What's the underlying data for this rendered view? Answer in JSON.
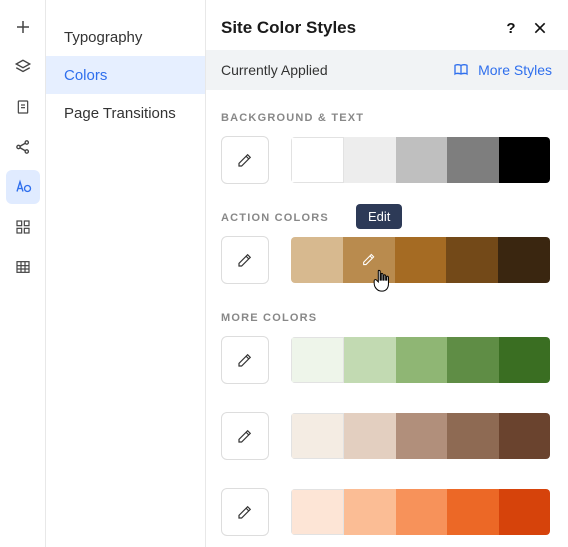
{
  "header": {
    "title": "Site Color Styles",
    "help": "?",
    "close": "×"
  },
  "applied_bar": {
    "label": "Currently Applied",
    "more_styles": "More Styles"
  },
  "menu": {
    "items": [
      {
        "label": "Typography",
        "active": false
      },
      {
        "label": "Colors",
        "active": true
      },
      {
        "label": "Page Transitions",
        "active": false
      }
    ]
  },
  "rail": {
    "items": [
      {
        "name": "add-icon"
      },
      {
        "name": "layers-icon"
      },
      {
        "name": "page-icon"
      },
      {
        "name": "share-icon"
      },
      {
        "name": "design-icon",
        "active": true
      },
      {
        "name": "grid-icon"
      },
      {
        "name": "table-icon"
      }
    ]
  },
  "sections": {
    "background_text": {
      "label": "BACKGROUND & TEXT",
      "swatches": [
        "#ffffff",
        "#ededed",
        "#bfbfbf",
        "#7e7e7e",
        "#000000"
      ]
    },
    "action_colors": {
      "label": "ACTION COLORS",
      "tooltip": "Edit",
      "swatches": [
        "#d7b98f",
        "#b98b4e",
        "#a56b23",
        "#734918",
        "#3a2610"
      ]
    },
    "more_colors": {
      "label": "MORE COLORS",
      "rows": [
        {
          "swatches": [
            "#eef5ea",
            "#c2dab2",
            "#8fb674",
            "#5f8d45",
            "#3a6e22"
          ]
        },
        {
          "swatches": [
            "#f4ece3",
            "#e3cfc0",
            "#b18f7b",
            "#8e6a53",
            "#6a432e"
          ]
        },
        {
          "swatches": [
            "#fde5d6",
            "#fbbd95",
            "#f7925a",
            "#ec6826",
            "#d6430b"
          ]
        }
      ]
    }
  }
}
